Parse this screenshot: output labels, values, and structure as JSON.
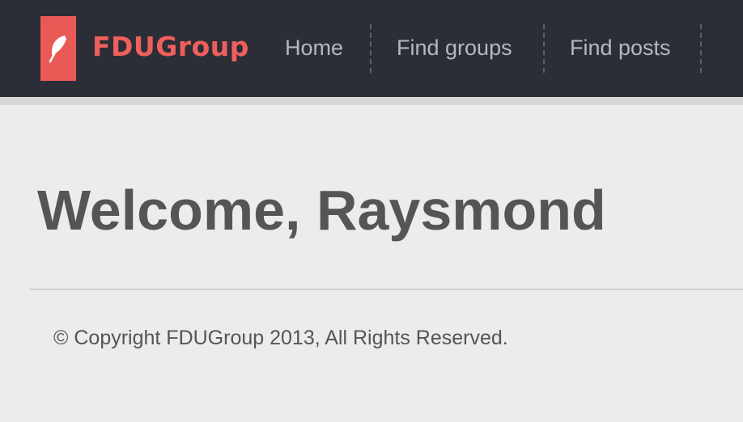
{
  "brand": {
    "name": "FDUGroup",
    "logo_icon": "feather-icon",
    "accent_color": "#e95a57"
  },
  "nav": {
    "items": [
      {
        "label": "Home"
      },
      {
        "label": "Find groups"
      },
      {
        "label": "Find posts"
      }
    ]
  },
  "main": {
    "title": "Welcome, Raysmond"
  },
  "footer": {
    "text": "© Copyright FDUGroup 2013, All Rights Reserved."
  }
}
